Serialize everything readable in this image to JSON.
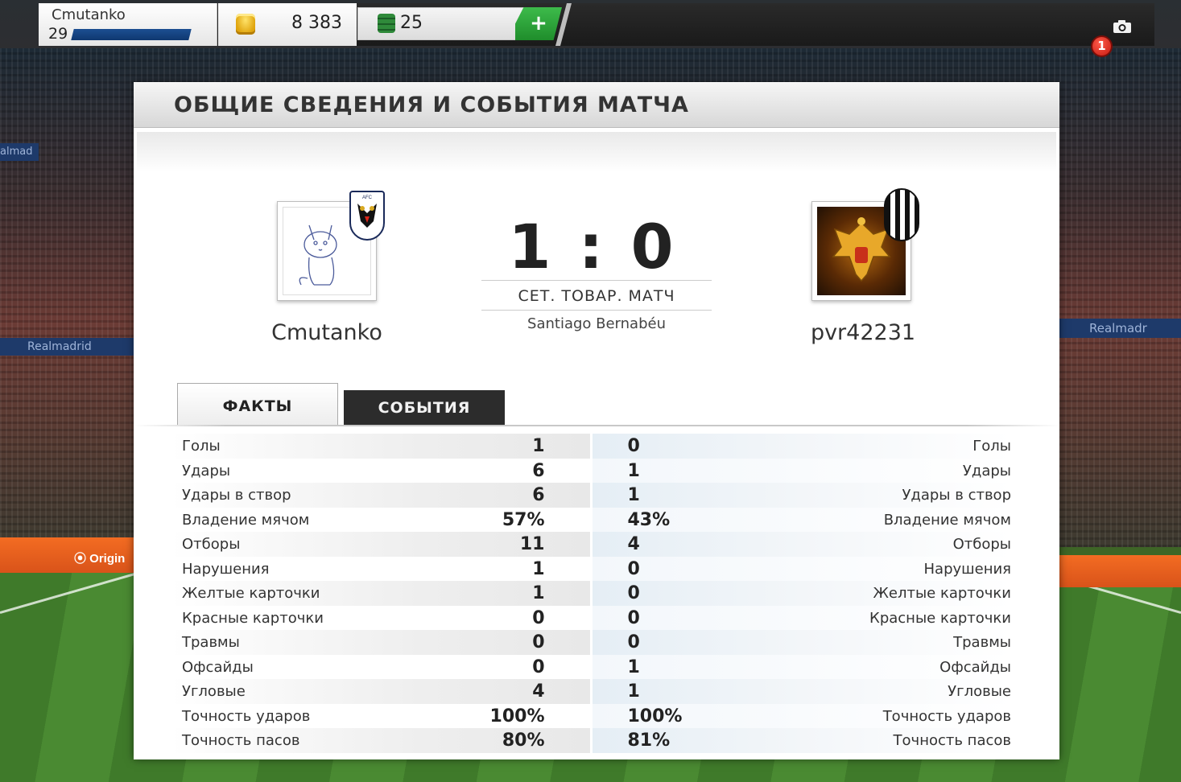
{
  "topbar": {
    "username": "Cmutanko",
    "level": "29",
    "coins": "8 383",
    "points": "25",
    "add_button": "+",
    "notification_count": "1"
  },
  "background": {
    "origin_logo": "Origin",
    "banner_left": "Realmadrid",
    "banner_left_small": "almad",
    "banner_right": "Realmadr"
  },
  "panel": {
    "title": "ОБЩИЕ СВЕДЕНИЯ И СОБЫТИЯ МАТЧА"
  },
  "match": {
    "home_player": "Cmutanko",
    "away_player": "pvr42231",
    "score": "1 : 0",
    "type": "СЕТ. ТОВАР. МАТЧ",
    "stadium": "Santiago Bernabéu"
  },
  "tabs": {
    "facts": "ФАКТЫ",
    "events": "СОБЫТИЯ"
  },
  "stats": [
    {
      "label": "Голы",
      "home": "1",
      "away": "0"
    },
    {
      "label": "Удары",
      "home": "6",
      "away": "1"
    },
    {
      "label": "Удары в створ",
      "home": "6",
      "away": "1"
    },
    {
      "label": "Владение мячом",
      "home": "57%",
      "away": "43%"
    },
    {
      "label": "Отборы",
      "home": "11",
      "away": "4"
    },
    {
      "label": "Нарушения",
      "home": "1",
      "away": "0"
    },
    {
      "label": "Желтые карточки",
      "home": "1",
      "away": "0"
    },
    {
      "label": "Красные карточки",
      "home": "0",
      "away": "0"
    },
    {
      "label": "Травмы",
      "home": "0",
      "away": "0"
    },
    {
      "label": "Офсайды",
      "home": "0",
      "away": "1"
    },
    {
      "label": "Угловые",
      "home": "4",
      "away": "1"
    },
    {
      "label": "Точность ударов",
      "home": "100%",
      "away": "100%"
    },
    {
      "label": "Точность пасов",
      "home": "80%",
      "away": "81%"
    }
  ],
  "colors": {
    "xp_bar": "#1c4f92",
    "add_button": "#2aa63a",
    "badge": "#d8261a",
    "events_tab": "#2c2c2c"
  },
  "icons": {
    "coins": "coin-stack-icon",
    "points": "points-stack-icon",
    "camera": "camera-icon",
    "home_crest": "afc-wimbledon-crest-icon",
    "away_crest": "juventus-crest-icon"
  }
}
